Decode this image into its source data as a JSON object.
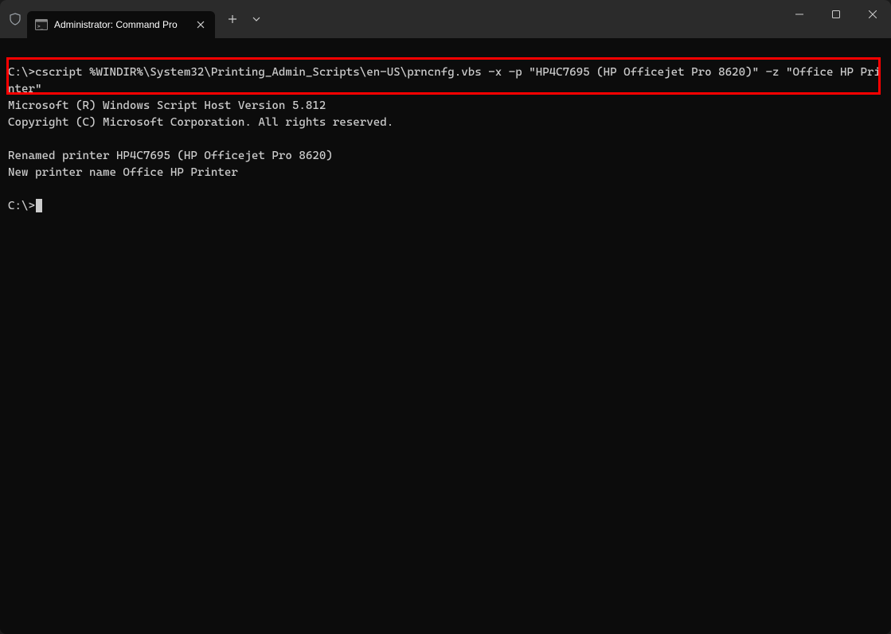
{
  "tab": {
    "title": "Administrator: Command Pro"
  },
  "terminal": {
    "line1": "C:\\>cscript %WINDIR%\\System32\\Printing_Admin_Scripts\\en-US\\prncnfg.vbs -x -p \"HP4C7695 (HP Officejet Pro 8620)\" -z \"Office HP Printer\"",
    "line2": "Microsoft (R) Windows Script Host Version 5.812",
    "line3": "Copyright (C) Microsoft Corporation. All rights reserved.",
    "line4": "Renamed printer HP4C7695 (HP Officejet Pro 8620)",
    "line5": "New printer name Office HP Printer",
    "prompt": "C:\\>"
  }
}
